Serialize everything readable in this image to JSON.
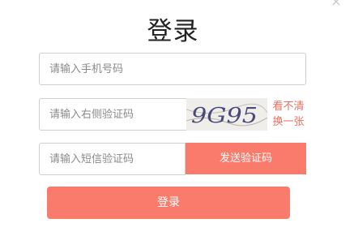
{
  "dialog": {
    "close_glyph": "×",
    "title": "登录"
  },
  "form": {
    "phone": {
      "placeholder": "请输入手机号码",
      "value": ""
    },
    "captcha": {
      "placeholder": "请输入右侧验证码",
      "value": ""
    },
    "captcha_image": {
      "text": "9G95"
    },
    "refresh_label_line1": "看不清",
    "refresh_label_line2": "换一张",
    "sms": {
      "placeholder": "请输入短信验证码",
      "value": ""
    },
    "send_code_label": "发送验证码",
    "login_label": "登录"
  },
  "colors": {
    "accent": "#fa7a6b",
    "link": "#f06f5f",
    "captcha_text": "#4a4a7a"
  }
}
